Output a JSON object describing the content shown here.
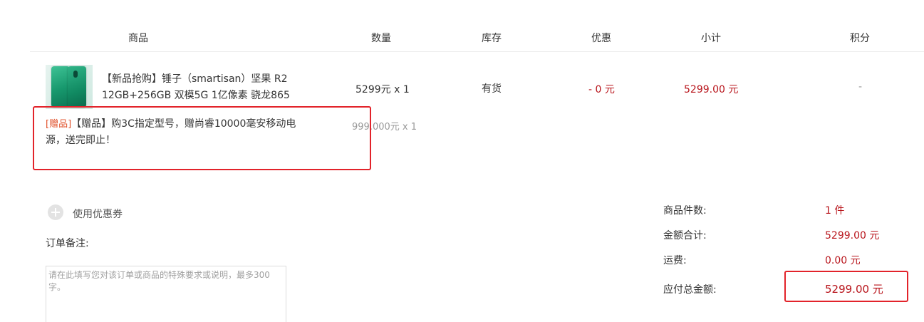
{
  "table": {
    "headers": {
      "product": "商品",
      "quantity": "数量",
      "stock": "库存",
      "discount": "优惠",
      "subtotal": "小计",
      "points": "积分"
    },
    "row": {
      "name_line1": "【新品抢购】锤子（smartisan）坚果 R2",
      "name_line2": "12GB+256GB 双模5G 1亿像素 骁龙865",
      "price_qty": "5299元 x 1",
      "stock": "有货",
      "discount": "- 0 元",
      "subtotal": "5299.00 元",
      "points": "-"
    },
    "gift": {
      "tag": "[赠品]",
      "text_line1": "【赠品】购3C指定型号，赠尚睿10000毫安移动电",
      "text_line2": "源，送完即止！",
      "price_qty": "999.000元 x 1"
    }
  },
  "coupon": {
    "label": "使用优惠券"
  },
  "remark": {
    "label": "订单备注:",
    "placeholder": "请在此填写您对该订单或商品的特殊要求或说明，最多300字。"
  },
  "summary": {
    "count_label": "商品件数:",
    "count_value": "1 件",
    "total_label": "金额合计:",
    "total_value": "5299.00 元",
    "shipping_label": "运费:",
    "shipping_value": "0.00 元",
    "payable_label": "应付总金额:",
    "payable_value": "5299.00 元"
  },
  "colors": {
    "price_red": "#b8141b",
    "highlight_border": "#e2232a",
    "gift_tag": "#e0502a"
  }
}
